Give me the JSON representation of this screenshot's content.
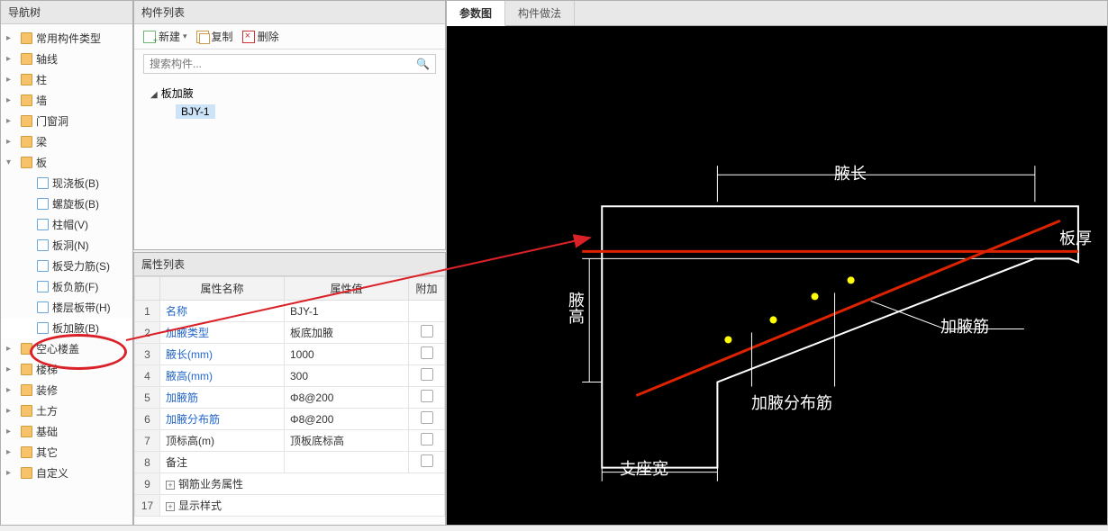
{
  "nav": {
    "title": "导航树",
    "items": [
      {
        "label": "常用构件类型",
        "icon": "folder"
      },
      {
        "label": "轴线",
        "icon": "folder"
      },
      {
        "label": "柱",
        "icon": "folder"
      },
      {
        "label": "墙",
        "icon": "folder"
      },
      {
        "label": "门窗洞",
        "icon": "folder"
      },
      {
        "label": "梁",
        "icon": "folder"
      },
      {
        "label": "板",
        "icon": "folder",
        "expanded": true,
        "children": [
          {
            "label": "现浇板(B)"
          },
          {
            "label": "螺旋板(B)"
          },
          {
            "label": "柱帽(V)"
          },
          {
            "label": "板洞(N)"
          },
          {
            "label": "板受力筋(S)"
          },
          {
            "label": "板负筋(F)"
          },
          {
            "label": "楼层板带(H)"
          },
          {
            "label": "板加腋(B)",
            "selected": true
          }
        ]
      },
      {
        "label": "空心楼盖",
        "icon": "folder"
      },
      {
        "label": "楼梯",
        "icon": "folder"
      },
      {
        "label": "装修",
        "icon": "folder"
      },
      {
        "label": "土方",
        "icon": "folder"
      },
      {
        "label": "基础",
        "icon": "folder"
      },
      {
        "label": "其它",
        "icon": "folder"
      },
      {
        "label": "自定义",
        "icon": "folder"
      }
    ]
  },
  "component_list": {
    "title": "构件列表",
    "toolbar": {
      "new": "新建",
      "copy": "复制",
      "delete": "删除"
    },
    "search_placeholder": "搜索构件...",
    "root": "板加腋",
    "selected_item": "BJY-1"
  },
  "properties": {
    "title": "属性列表",
    "columns": {
      "name": "属性名称",
      "value": "属性值",
      "extra": "附加"
    },
    "rows": [
      {
        "n": "1",
        "name": "名称",
        "value": "BJY-1",
        "link": true,
        "chk": false
      },
      {
        "n": "2",
        "name": "加腋类型",
        "value": "板底加腋",
        "link": true,
        "chk": true
      },
      {
        "n": "3",
        "name": "腋长(mm)",
        "value": "1000",
        "link": true,
        "chk": true
      },
      {
        "n": "4",
        "name": "腋高(mm)",
        "value": "300",
        "link": true,
        "chk": true
      },
      {
        "n": "5",
        "name": "加腋筋",
        "value": "Φ8@200",
        "link": true,
        "chk": true
      },
      {
        "n": "6",
        "name": "加腋分布筋",
        "value": "Φ8@200",
        "link": true,
        "chk": true
      },
      {
        "n": "7",
        "name": "顶标高(m)",
        "value": "顶板底标高",
        "link": false,
        "chk": true
      },
      {
        "n": "8",
        "name": "备注",
        "value": "",
        "link": false,
        "chk": true
      },
      {
        "n": "9",
        "name": "钢筋业务属性",
        "value": "",
        "group": true
      },
      {
        "n": "17",
        "name": "显示样式",
        "value": "",
        "group": true
      }
    ]
  },
  "param_tabs": {
    "tab1": "参数图",
    "tab2": "构件做法"
  },
  "diagram_labels": {
    "ye_chang": "腋长",
    "ban_hou": "板厚",
    "ye_gao": "腋高",
    "jia_ye_jin": "加腋筋",
    "jia_ye_fenbu_jin": "加腋分布筋",
    "zhizuo_kuan": "支座宽"
  }
}
